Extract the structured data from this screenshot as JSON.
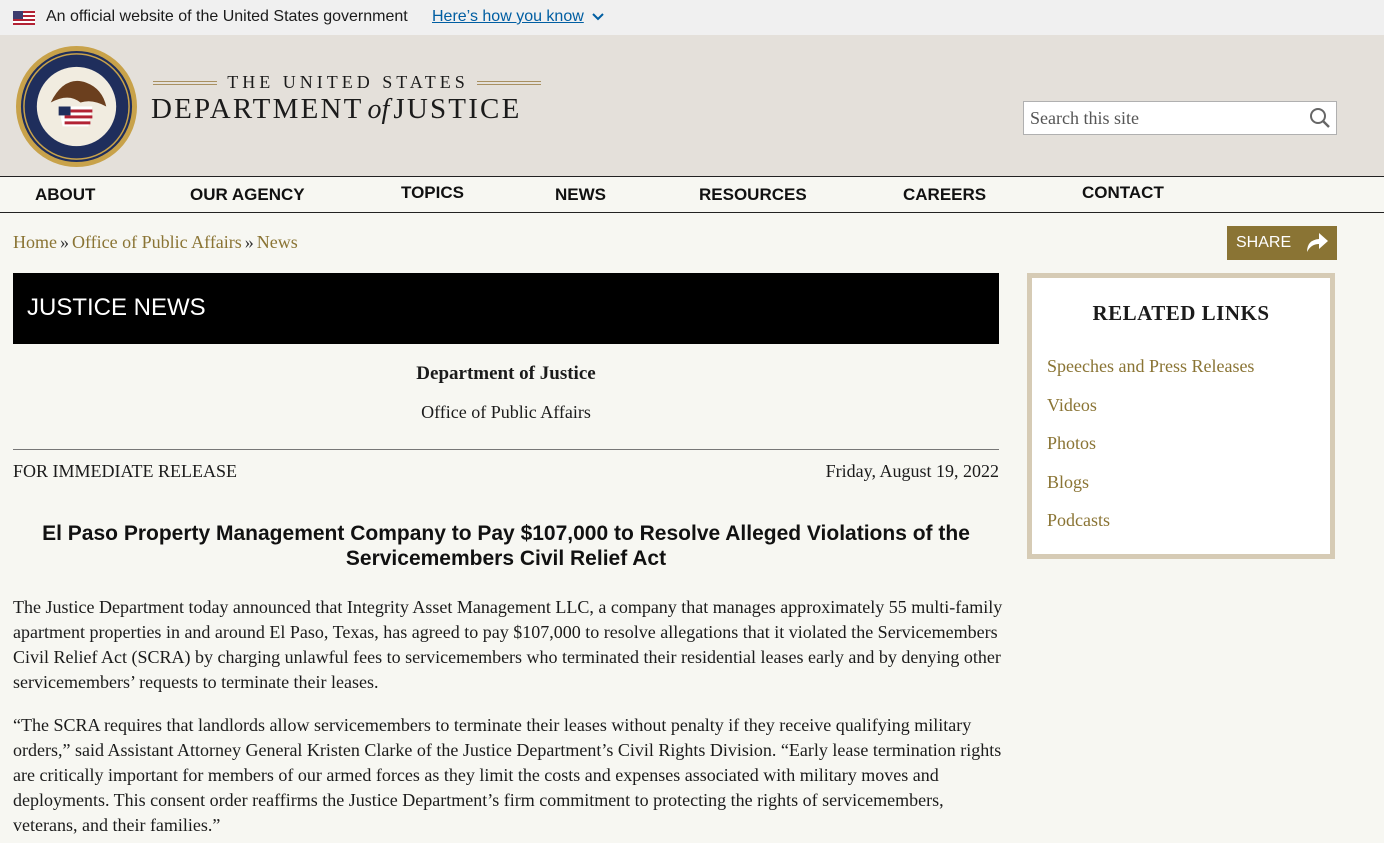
{
  "gov_banner": {
    "text": "An official website of the United States government",
    "link": "Here’s how you know"
  },
  "header": {
    "logo_top": "THE UNITED STATES",
    "logo_dept": "DEPARTMENT",
    "logo_of": "of",
    "logo_justice": "JUSTICE",
    "search_placeholder": "Search this site"
  },
  "nav": {
    "items": [
      "ABOUT",
      "OUR AGENCY",
      "TOPICS",
      "NEWS",
      "RESOURCES",
      "CAREERS",
      "CONTACT"
    ]
  },
  "breadcrumb": {
    "items": [
      "Home",
      "Office of Public Affairs",
      "News"
    ],
    "separator": "»"
  },
  "share": {
    "label": "SHARE"
  },
  "section": {
    "title": "JUSTICE NEWS"
  },
  "article": {
    "department": "Department of Justice",
    "office": "Office of Public Affairs",
    "release": "FOR IMMEDIATE RELEASE",
    "date": "Friday, August 19, 2022",
    "headline": "El Paso Property Management Company to Pay $107,000 to Resolve Alleged Violations of the Servicemembers Civil Relief Act",
    "paragraphs": [
      "The Justice Department today announced that Integrity Asset Management LLC, a company that manages approximately 55 multi-family apartment properties in and around El Paso, Texas, has agreed to pay $107,000 to resolve allegations that it violated the Servicemembers Civil Relief Act (SCRA) by charging unlawful fees to servicemembers who terminated their residential leases early and by denying other servicemembers’ requests to terminate their leases.",
      "“The SCRA requires that landlords allow servicemembers to terminate their leases without penalty if they receive qualifying military orders,” said Assistant Attorney General Kristen Clarke of the Justice Department’s Civil Rights Division. “Early lease termination rights are critically important for members of our armed forces as they limit the costs and expenses associated with military moves and deployments. This consent order reaffirms the Justice Department’s firm commitment to protecting the rights of servicemembers, veterans, and their families.”"
    ]
  },
  "related": {
    "title": "RELATED LINKS",
    "links": [
      "Speeches and Press Releases",
      "Videos",
      "Photos",
      "Blogs",
      "Podcasts"
    ]
  },
  "colors": {
    "gold_link": "#8a7434",
    "header_bg": "#e4e0da",
    "gov_link": "#005ea2"
  }
}
